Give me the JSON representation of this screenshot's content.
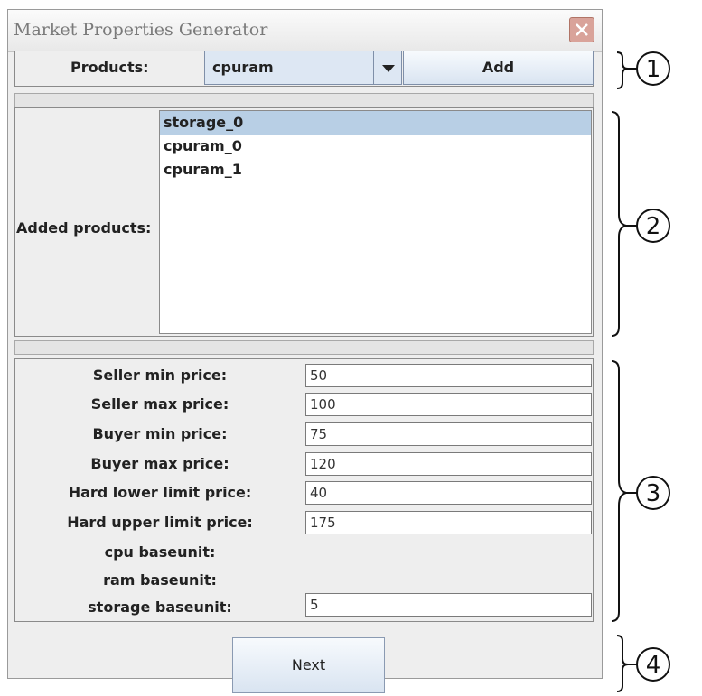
{
  "window": {
    "title": "Market Properties Generator"
  },
  "products_row": {
    "label": "Products:",
    "selected": "cpuram",
    "add_label": "Add"
  },
  "added_products": {
    "label": "Added products:",
    "items": [
      "storage_0",
      "cpuram_0",
      "cpuram_1"
    ],
    "selected_index": 0
  },
  "fields": [
    {
      "label": "Seller min price:",
      "value": "50"
    },
    {
      "label": "Seller max price:",
      "value": "100"
    },
    {
      "label": "Buyer min price:",
      "value": "75"
    },
    {
      "label": "Buyer max price:",
      "value": "120"
    },
    {
      "label": "Hard lower limit price:",
      "value": "40"
    },
    {
      "label": "Hard upper limit price:",
      "value": "175"
    },
    {
      "label": "cpu baseunit:",
      "value": null
    },
    {
      "label": "ram baseunit:",
      "value": null
    },
    {
      "label": "storage baseunit:",
      "value": "5"
    }
  ],
  "footer": {
    "next_label": "Next"
  },
  "callouts": [
    "1",
    "2",
    "3",
    "4"
  ],
  "colors": {
    "selection": "#b8cfe5",
    "button_top": "#f7fafd",
    "button_bottom": "#d9e4f1"
  }
}
